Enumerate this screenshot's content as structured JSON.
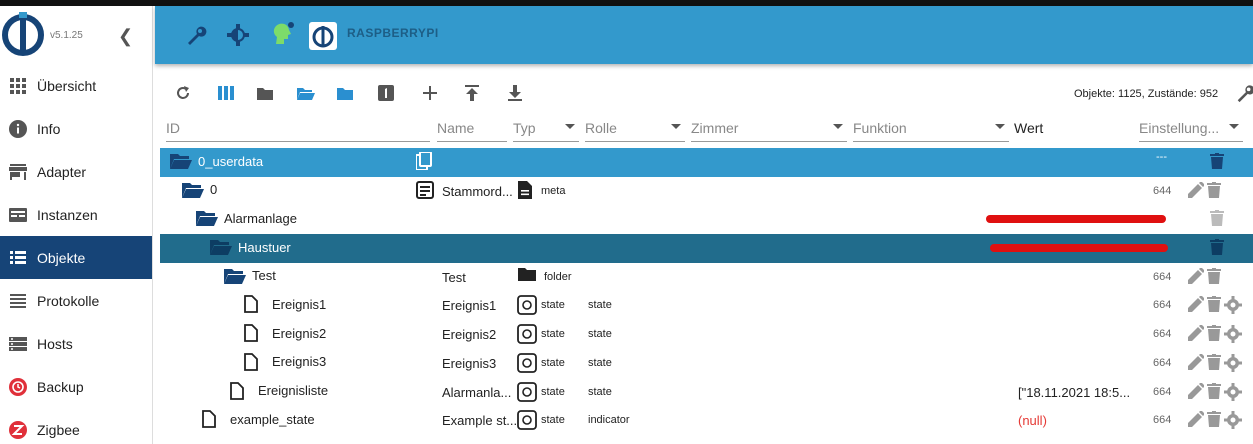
{
  "sidebar": {
    "version": "v5.1.25",
    "items": [
      {
        "label": "Übersicht",
        "icon": "grid-icon"
      },
      {
        "label": "Info",
        "icon": "info-icon"
      },
      {
        "label": "Adapter",
        "icon": "store-icon"
      },
      {
        "label": "Instanzen",
        "icon": "instances-icon"
      },
      {
        "label": "Objekte",
        "icon": "list-icon",
        "active": true
      },
      {
        "label": "Protokolle",
        "icon": "menu-icon"
      },
      {
        "label": "Hosts",
        "icon": "hosts-icon"
      },
      {
        "label": "Backup",
        "icon": "backup-icon"
      },
      {
        "label": "Zigbee",
        "icon": "zigbee-icon"
      }
    ]
  },
  "header": {
    "hostname": "RASPBERRYPI",
    "accent": "#3399cc"
  },
  "toolbar": {
    "stats": "Objekte: 1125, Zustände: 952"
  },
  "filters": {
    "id": "ID",
    "name": "Name",
    "typ": "Typ",
    "rolle": "Rolle",
    "zimmer": "Zimmer",
    "funktion": "Funktion",
    "wert": "Wert",
    "einstellungen": "Einstellung..."
  },
  "rows": [
    {
      "label": "0_userdata",
      "name": "",
      "type": "",
      "role": "",
      "value": "",
      "acl": "---"
    },
    {
      "label": "0",
      "name": "Stammord...",
      "type": "meta",
      "role": "",
      "value": "",
      "acl": "644"
    },
    {
      "label": "Alarmanlage",
      "name": "",
      "type": "",
      "role": "",
      "value": "",
      "acl": ""
    },
    {
      "label": "Haustuer",
      "name": "",
      "type": "",
      "role": "",
      "value": "",
      "acl": ""
    },
    {
      "label": "Test",
      "name": "Test",
      "type": "folder",
      "role": "",
      "value": "",
      "acl": "664"
    },
    {
      "label": "Ereignis1",
      "name": "Ereignis1",
      "type": "state",
      "role": "state",
      "value": "",
      "acl": "664"
    },
    {
      "label": "Ereignis2",
      "name": "Ereignis2",
      "type": "state",
      "role": "state",
      "value": "",
      "acl": "664"
    },
    {
      "label": "Ereignis3",
      "name": "Ereignis3",
      "type": "state",
      "role": "state",
      "value": "",
      "acl": "664"
    },
    {
      "label": "Ereignisliste",
      "name": "Alarmanla...",
      "type": "state",
      "role": "state",
      "value": "[\"18.11.2021 18:5...",
      "acl": "664"
    },
    {
      "label": "example_state",
      "name": "Example st...",
      "type": "state",
      "role": "indicator",
      "value": "(null)",
      "acl": "664"
    }
  ]
}
